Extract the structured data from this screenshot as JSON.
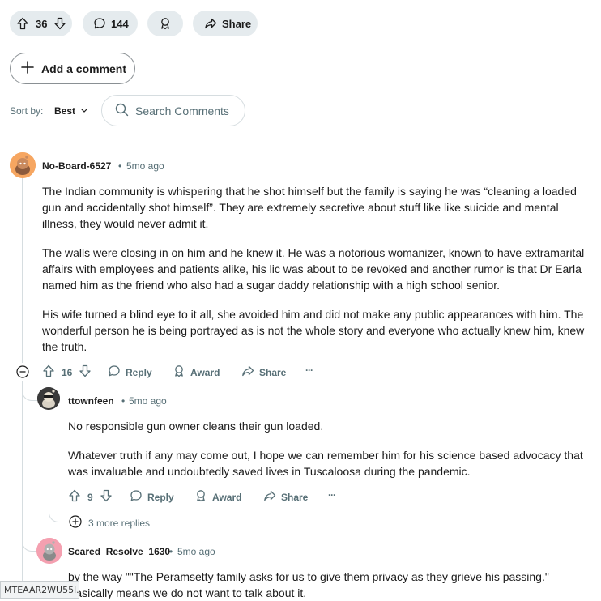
{
  "post_actions": {
    "vote_count": "36",
    "comment_count": "144",
    "share_label": "Share"
  },
  "add_comment_label": "Add a comment",
  "sort": {
    "label": "Sort by:",
    "value": "Best"
  },
  "search": {
    "placeholder": "Search Comments"
  },
  "comments": [
    {
      "username": "No-Board-6527",
      "time": "5mo ago",
      "paragraphs": [
        "The Indian community is whispering that he shot himself but the family is saying he was “cleaning a loaded gun and accidentally shot himself”. They are extremely secretive about stuff like like suicide and mental illness, they would never admit it.",
        "The walls were closing in on him and he knew it. He was a notorious womanizer, known to have extramarital affairs with employees and patients alike, his lic was about to be revoked and another rumor is that Dr Earla named him as the friend who also had a sugar daddy relationship with a high school senior.",
        "His wife turned a blind eye to it all, she avoided him and did not make any public appearances with him. The wonderful person he is being portrayed as is not the whole story and everyone who actually knew him, knew the truth."
      ],
      "votes": "16",
      "reply_label": "Reply",
      "award_label": "Award",
      "share_label": "Share",
      "more_label": "···"
    },
    {
      "username": "ttownfeen",
      "time": "5mo ago",
      "paragraphs": [
        "No responsible gun owner cleans their gun loaded.",
        "Whatever truth if any may come out, I hope we can remember him for his science based advocacy that was invaluable and undoubtedly saved lives in Tuscaloosa during the pandemic."
      ],
      "votes": "9",
      "reply_label": "Reply",
      "award_label": "Award",
      "share_label": "Share",
      "more_label": "···"
    },
    {
      "username": "Scared_Resolve_1630",
      "time": "5mo ago",
      "paragraphs": [
        "by the way \"\"The Peramsetty family asks for us to give them privacy as they grieve his passing.\" Basically means we do not want to talk about it."
      ]
    }
  ],
  "more_replies_label": "3 more replies",
  "status_text": "MTEAAR2WU55l...",
  "colors": {
    "pill_bg": "#e5ebee",
    "muted_text": "#576f76",
    "avatar_orange": "#f6a661",
    "avatar_pink": "#f4a0b0"
  },
  "time_separator": "•"
}
